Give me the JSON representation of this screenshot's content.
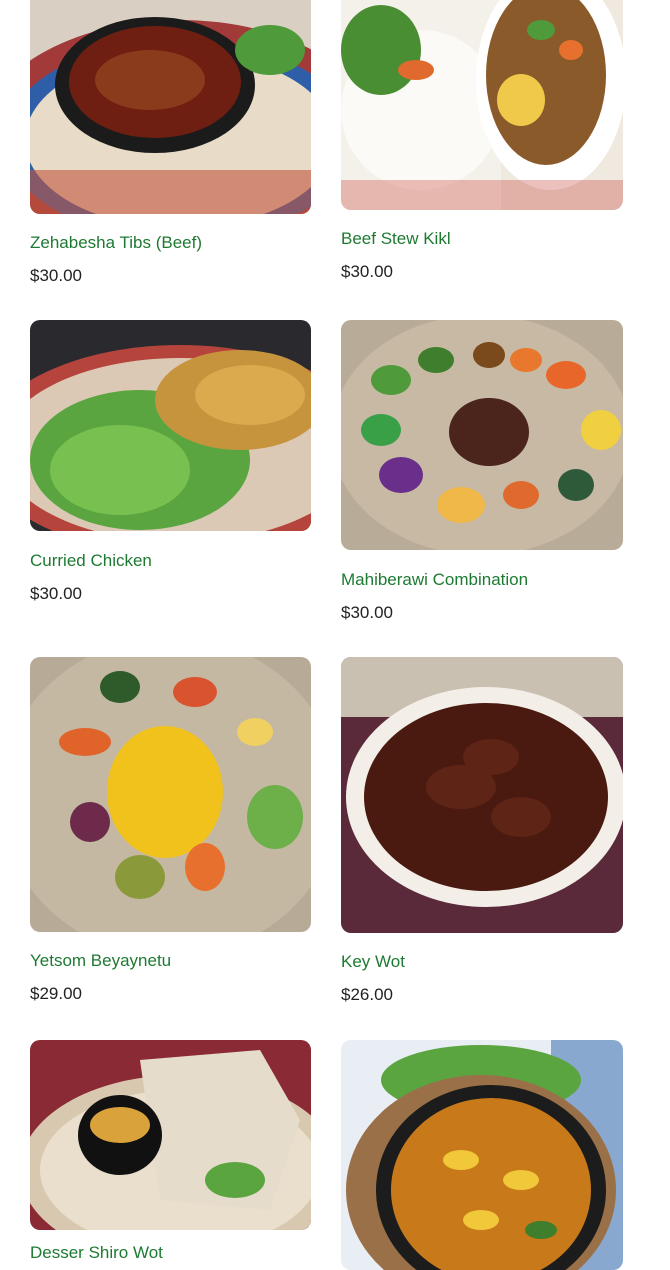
{
  "colors": {
    "title": "#1e7a32",
    "price": "#222222",
    "background": "#ffffff"
  },
  "products": [
    {
      "name": "Zehabesha Tibs (Beef)",
      "price": "$30.00",
      "image": "beef-tibs-clay-pot-photo"
    },
    {
      "name": "Beef Stew Kikl",
      "price": "$30.00",
      "image": "beef-stew-rice-photo"
    },
    {
      "name": "Curried Chicken",
      "price": "$30.00",
      "image": "curried-chicken-salad-photo"
    },
    {
      "name": "Mahiberawi Combination",
      "price": "$30.00",
      "image": "combination-platter-photo"
    },
    {
      "name": "Yetsom Beyaynetu",
      "price": "$29.00",
      "image": "vegan-platter-photo"
    },
    {
      "name": "Key Wot",
      "price": "$26.00",
      "image": "red-beef-stew-dish-photo"
    },
    {
      "name": "Desser Shiro Wot",
      "price": "",
      "image": "shiro-pot-injera-photo"
    },
    {
      "name": "",
      "price": "",
      "image": "pasta-soup-bowl-photo"
    }
  ]
}
